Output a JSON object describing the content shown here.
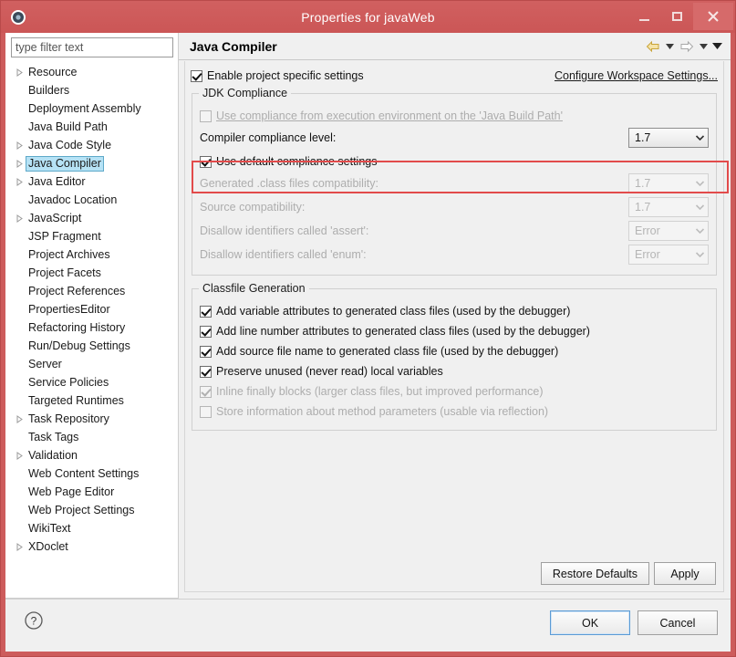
{
  "window": {
    "title": "Properties for javaWeb",
    "icon": "gear-icon",
    "minimize_label": "Minimize",
    "maximize_label": "Maximize",
    "close_label": "Close",
    "accent_color": "#cd5c5c"
  },
  "sidebar": {
    "filter": {
      "placeholder": "type filter text",
      "value": ""
    },
    "items": [
      {
        "label": "Resource",
        "expandable": true,
        "selected": false
      },
      {
        "label": "Builders",
        "expandable": false,
        "selected": false
      },
      {
        "label": "Deployment Assembly",
        "expandable": false,
        "selected": false
      },
      {
        "label": "Java Build Path",
        "expandable": false,
        "selected": false
      },
      {
        "label": "Java Code Style",
        "expandable": true,
        "selected": false
      },
      {
        "label": "Java Compiler",
        "expandable": true,
        "selected": true
      },
      {
        "label": "Java Editor",
        "expandable": true,
        "selected": false
      },
      {
        "label": "Javadoc Location",
        "expandable": false,
        "selected": false
      },
      {
        "label": "JavaScript",
        "expandable": true,
        "selected": false
      },
      {
        "label": "JSP Fragment",
        "expandable": false,
        "selected": false
      },
      {
        "label": "Project Archives",
        "expandable": false,
        "selected": false
      },
      {
        "label": "Project Facets",
        "expandable": false,
        "selected": false
      },
      {
        "label": "Project References",
        "expandable": false,
        "selected": false
      },
      {
        "label": "PropertiesEditor",
        "expandable": false,
        "selected": false
      },
      {
        "label": "Refactoring History",
        "expandable": false,
        "selected": false
      },
      {
        "label": "Run/Debug Settings",
        "expandable": false,
        "selected": false
      },
      {
        "label": "Server",
        "expandable": false,
        "selected": false
      },
      {
        "label": "Service Policies",
        "expandable": false,
        "selected": false
      },
      {
        "label": "Targeted Runtimes",
        "expandable": false,
        "selected": false
      },
      {
        "label": "Task Repository",
        "expandable": true,
        "selected": false
      },
      {
        "label": "Task Tags",
        "expandable": false,
        "selected": false
      },
      {
        "label": "Validation",
        "expandable": true,
        "selected": false
      },
      {
        "label": "Web Content Settings",
        "expandable": false,
        "selected": false
      },
      {
        "label": "Web Page Editor",
        "expandable": false,
        "selected": false
      },
      {
        "label": "Web Project Settings",
        "expandable": false,
        "selected": false
      },
      {
        "label": "WikiText",
        "expandable": false,
        "selected": false
      },
      {
        "label": "XDoclet",
        "expandable": true,
        "selected": false
      }
    ]
  },
  "page": {
    "title": "Java Compiler",
    "nav": {
      "back_icon": "back-arrow-icon",
      "back_menu_icon": "chevron-down-icon",
      "forward_icon": "forward-arrow-icon",
      "forward_menu_icon": "chevron-down-icon",
      "view_menu_icon": "chevron-down-icon"
    },
    "enable_project_specific": {
      "label": "Enable project specific settings",
      "checked": true
    },
    "configure_workspace_link": "Configure Workspace Settings...",
    "jdk_compliance": {
      "group_title": "JDK Compliance",
      "use_execution_env": {
        "label": "Use compliance from execution environment on the 'Java Build Path'",
        "checked": false,
        "enabled": false
      },
      "compiler_compliance_level": {
        "label": "Compiler compliance level:",
        "value": "1.7",
        "enabled": true,
        "highlighted": true
      },
      "use_default_compliance": {
        "label": "Use default compliance settings",
        "checked": true,
        "enabled": true
      },
      "fields": [
        {
          "label": "Generated .class files compatibility:",
          "value": "1.7",
          "enabled": false
        },
        {
          "label": "Source compatibility:",
          "value": "1.7",
          "enabled": false
        },
        {
          "label": "Disallow identifiers called 'assert':",
          "value": "Error",
          "enabled": false
        },
        {
          "label": "Disallow identifiers called 'enum':",
          "value": "Error",
          "enabled": false
        }
      ]
    },
    "classfile_generation": {
      "group_title": "Classfile Generation",
      "options": [
        {
          "label": "Add variable attributes to generated class files (used by the debugger)",
          "checked": true,
          "enabled": true
        },
        {
          "label": "Add line number attributes to generated class files (used by the debugger)",
          "checked": true,
          "enabled": true
        },
        {
          "label": "Add source file name to generated class file (used by the debugger)",
          "checked": true,
          "enabled": true
        },
        {
          "label": "Preserve unused (never read) local variables",
          "checked": true,
          "enabled": true
        },
        {
          "label": "Inline finally blocks (larger class files, but improved performance)",
          "checked": true,
          "enabled": false
        },
        {
          "label": "Store information about method parameters (usable via reflection)",
          "checked": false,
          "enabled": false
        }
      ]
    },
    "inner_buttons": {
      "restore_defaults": "Restore Defaults",
      "apply": "Apply"
    }
  },
  "footer": {
    "help_icon": "help-question-icon",
    "ok": "OK",
    "cancel": "Cancel"
  },
  "annotation": {
    "color": "#e24b4b",
    "target": "Compiler compliance level:"
  }
}
